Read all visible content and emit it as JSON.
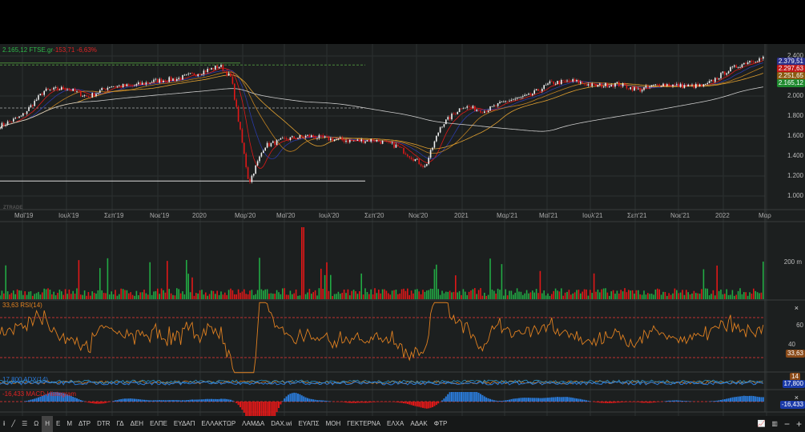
{
  "header": {
    "last": "2.165,12",
    "symbol": "FTSE.gr",
    "change": "-153,71",
    "change_pct": "-6,63%"
  },
  "watermark": "ZTRADE",
  "price_axis": [
    "2.400",
    "2.000",
    "1.800",
    "1.600",
    "1.400",
    "1.200",
    "1.000"
  ],
  "price_tags": [
    {
      "text": "2.379,51",
      "color": "#2a2f8a"
    },
    {
      "text": "2.297,63",
      "color": "#c01818"
    },
    {
      "text": "2.251,65",
      "color": "#8a5a10"
    },
    {
      "text": "2.165,12",
      "color": "#1f8a2f"
    }
  ],
  "time_axis": [
    "Μαϊ'19",
    "Ιουλ'19",
    "Σεπ'19",
    "Νοε'19",
    "2020",
    "Μαρ'20",
    "Μαϊ'20",
    "Ιουλ'20",
    "Σεπ'20",
    "Νοε'20",
    "2021",
    "Μαρ'21",
    "Μαϊ'21",
    "Ιουλ'21",
    "Σεπ'21",
    "Νοε'21",
    "2022",
    "Μαρ"
  ],
  "volume": {
    "axis_label": "200 m"
  },
  "rsi": {
    "label": "33,63 RSI(14)",
    "axis": [
      "60",
      "40"
    ],
    "tag": "33,63"
  },
  "adx": {
    "label": "17,800 ADX(14)",
    "tag": "17,800",
    "tag2": "14"
  },
  "macd": {
    "label": "-16,433 MACD-Histogram",
    "tag": "-16,433"
  },
  "close_label": "×",
  "toolbar": {
    "items": [
      "Ω",
      "Η",
      "Ε",
      "Μ",
      "ΔΤΡ",
      "DTR",
      "ΓΔ",
      "ΔΕΗ",
      "ΕΛΠΕ",
      "ΕΥΔΑΠ",
      "ΕΛΛΑΚΤΩΡ",
      "ΛΑΜΔΑ",
      "DAX.wi",
      "ΕΥΑΠΣ",
      "ΜΟΗ",
      "ΓΕΚΤΕΡΝΑ",
      "ΕΛΧΑ",
      "ΑΔΑΚ",
      "ΦΤΡ"
    ],
    "active": "Η",
    "minus": "−",
    "plus": "+"
  },
  "colors": {
    "up": "#22aa44",
    "down": "#e01818",
    "rsi": "#e08020",
    "adx": "#2a7ad8",
    "macd_pos": "#2a7ad8",
    "macd_neg": "#e01818"
  },
  "chart_data": {
    "type": "line",
    "title": "FTSE.gr",
    "x_months_from_apr2019": [
      0,
      1,
      2,
      3,
      4,
      5,
      6,
      7,
      8,
      9,
      10,
      10.5,
      11.3,
      12,
      13,
      14,
      15,
      16,
      17,
      18,
      19.3,
      20,
      21,
      22,
      23,
      24,
      25,
      26,
      27,
      28,
      29,
      30,
      31,
      32,
      33,
      34,
      34.7,
      35.2
    ],
    "close": [
      1700,
      1800,
      2050,
      2080,
      1990,
      2100,
      2100,
      2150,
      2170,
      2230,
      2300,
      2180,
      1130,
      1500,
      1570,
      1600,
      1570,
      1550,
      1560,
      1500,
      1290,
      1700,
      1900,
      1850,
      1950,
      2000,
      2130,
      2150,
      2100,
      2120,
      2060,
      2120,
      2100,
      2100,
      2250,
      2350,
      2380,
      2165
    ],
    "ylim": [
      950,
      2450
    ],
    "reference_lines": [
      2310,
      1880,
      1150
    ]
  }
}
